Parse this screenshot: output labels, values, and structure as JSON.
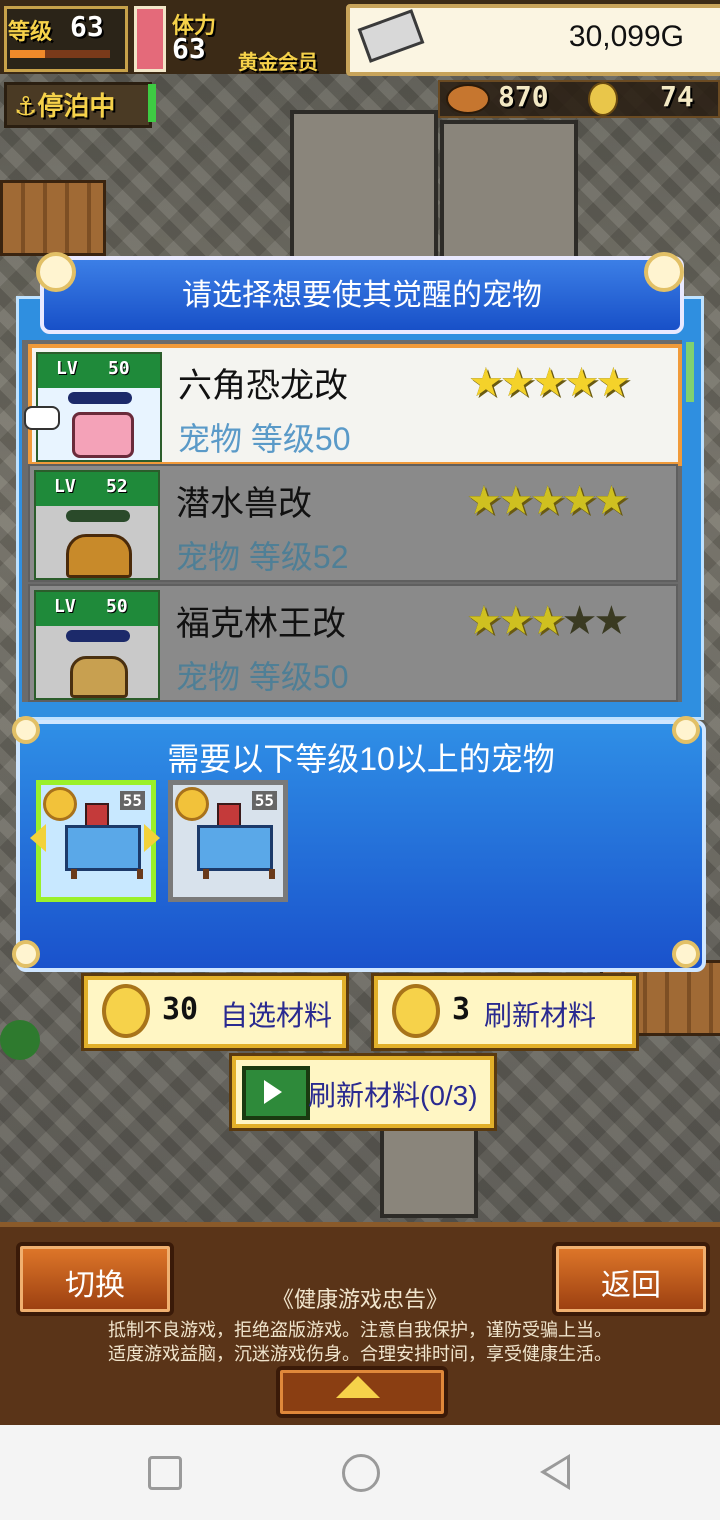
{
  "hud": {
    "level_label": "等级",
    "level_value": "63",
    "level_progress": 0.35,
    "stamina_label": "体力",
    "stamina_value": "63",
    "membership": "黄金会员",
    "money": "30,099G",
    "docked_label": "停泊中",
    "resource1_value": "870",
    "resource2_value": "74"
  },
  "select_panel": {
    "title": "请选择想要使其觉醒的宠物",
    "pets": [
      {
        "lv_badge": "LV",
        "lv": "50",
        "name": "六角恐龙改",
        "sub": "宠物 等级50",
        "stars": 5,
        "max_stars": 5,
        "selected": true
      },
      {
        "lv_badge": "LV",
        "lv": "52",
        "name": "潜水兽改",
        "sub": "宠物 等级52",
        "stars": 5,
        "max_stars": 5,
        "selected": false
      },
      {
        "lv_badge": "LV",
        "lv": "50",
        "name": "福克林王改",
        "sub": "宠物 等级50",
        "stars": 3,
        "max_stars": 5,
        "selected": false
      }
    ]
  },
  "requirement_panel": {
    "text": "需要以下等级10以上的宠物",
    "cards": [
      {
        "level": "55",
        "selected": true
      },
      {
        "level": "55",
        "selected": false
      }
    ]
  },
  "buttons": {
    "select_cost": "30",
    "select_label": "自选材料",
    "refresh_cost": "3",
    "refresh_label": "刷新材料",
    "ad_refresh_label": "刷新材料(0/3)"
  },
  "bottom": {
    "switch_label": "切换",
    "back_label": "返回",
    "notice_title": "《健康游戏忠告》",
    "notice_line1": "抵制不良游戏，拒绝盗版游戏。注意自我保护，谨防受骗上当。",
    "notice_line2": "适度游戏益脑，沉迷游戏伤身。合理安排时间，享受健康生活。"
  },
  "icons": {
    "money": "silver-bar-icon",
    "dock": "anchor-icon",
    "resource1": "food-icon",
    "resource2": "medal-icon",
    "coin": "gold-coin-icon",
    "ad": "tv-play-icon"
  }
}
